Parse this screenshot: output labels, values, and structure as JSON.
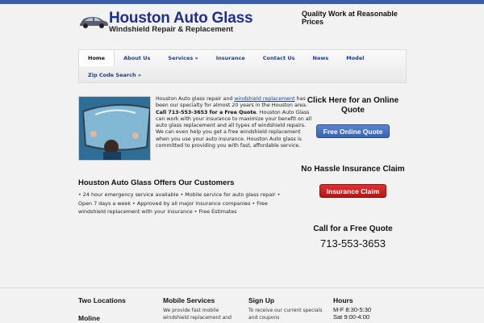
{
  "header": {
    "logo_title": "Houston Auto Glass",
    "logo_subtitle": "Windshield Repair & Replacement",
    "tagline": "Quality Work at Reasonable Prices"
  },
  "nav": {
    "row1": [
      "Home",
      "About Us",
      "Services »",
      "Insurance",
      "Contact Us",
      "News",
      "Model"
    ],
    "row2": [
      "Zip Code Search »"
    ]
  },
  "main": {
    "intro_pre": "Houston Auto glass repair and ",
    "intro_link": "windshield replacement",
    "intro_mid": " has been our specialty for almost 20 years in the Houston area. ",
    "intro_bold": "Call 713-553-3653 for a Free Quote",
    "intro_post": ". Houston Auto Glass can work with your insurance to maximize your benefit on all auto glass replacement and all types of windshield repairs. We can even help you get a free windshield replacement when you use your auto insurance. Houston Auto glass is committed to providing you with fast, affordable service.",
    "offers_heading": "Houston Auto Glass Offers Our Customers",
    "offers_text": "• 24 hour emergency service available • Mobile service for auto glass repair • Open 7 days a week • Approved by all major insurance companies • Free windshield replacement with your insurance • Free Estimates"
  },
  "sidebar": {
    "quote_heading": "Click Here for an Online Quote",
    "quote_button": "Free Online Quote",
    "insurance_heading": "No Hassle Insurance Claim",
    "insurance_button": "Insurance Claim",
    "call_heading": "Call for a Free Quote",
    "phone": "713-553-3653"
  },
  "footer": {
    "col1_heading": "Two Locations",
    "col1_sub": "Moline",
    "col2_heading": "Mobile Services",
    "col2_text": "We provide fast mobile windshield replacement and",
    "col3_heading": "Sign Up",
    "col3_text": "To receive our current specials and coupons",
    "col4_heading": "Hours",
    "col4_line1": "M-F 8:30-5:30",
    "col4_line2": "Sat 9:00-4:00"
  },
  "colors": {
    "accent_blue": "#1e2f8c",
    "button_blue": "#3562b2",
    "button_red": "#b51818",
    "top_bar": "#3a5fa8"
  }
}
